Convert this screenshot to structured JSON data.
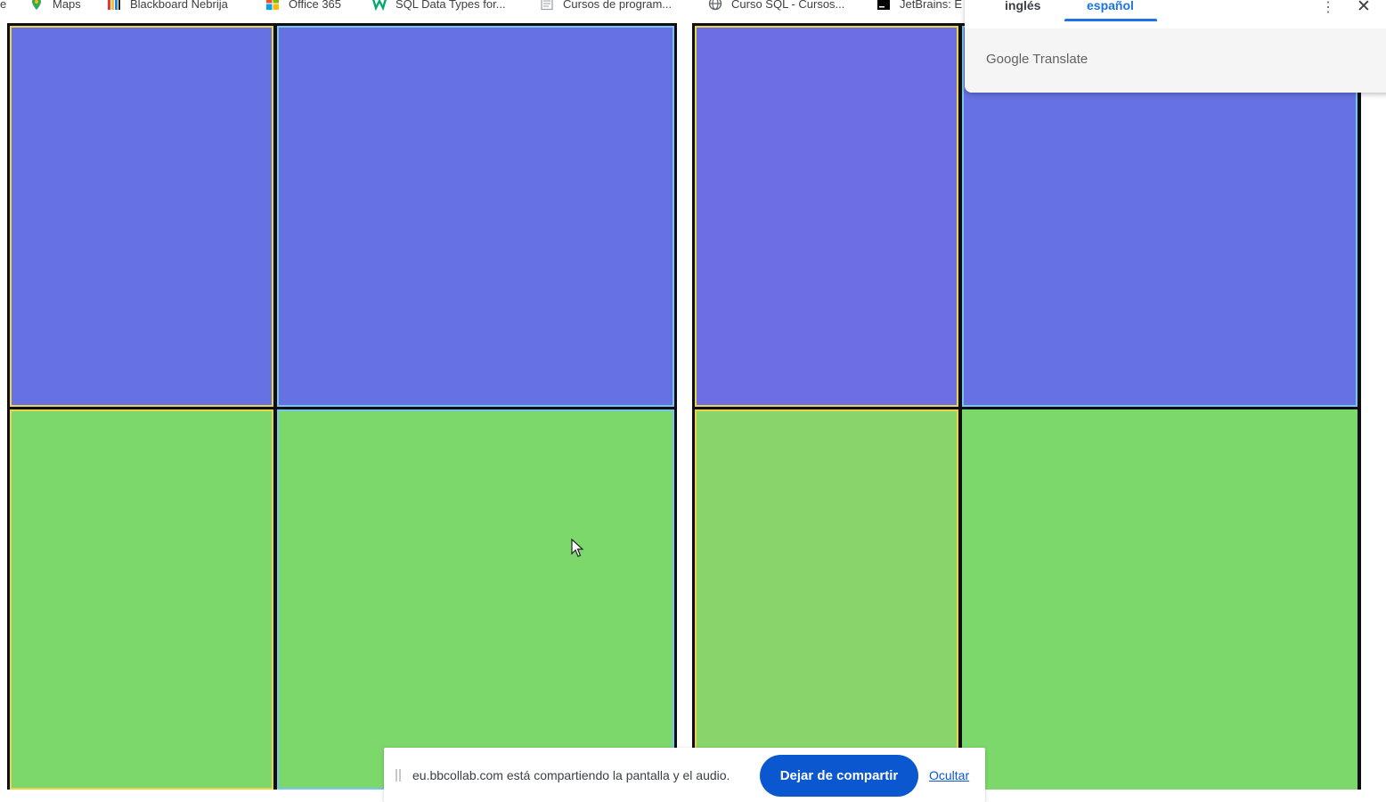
{
  "bookmarks": [
    {
      "label": "e",
      "icon": "page-edge-icon"
    },
    {
      "label": "Maps",
      "icon": "maps-pin-icon"
    },
    {
      "label": "Blackboard Nebrija",
      "icon": "blackboard-icon"
    },
    {
      "label": "Office 365",
      "icon": "office-icon"
    },
    {
      "label": "SQL Data Types for...",
      "icon": "w3schools-icon"
    },
    {
      "label": "Cursos de program...",
      "icon": "document-icon"
    },
    {
      "label": "Curso SQL - Cursos...",
      "icon": "globe-icon"
    },
    {
      "label": "JetBrains: E",
      "icon": "jetbrains-icon"
    }
  ],
  "translate_popup": {
    "source_language": "inglés",
    "target_language": "español",
    "brand": "Google Translate",
    "menu_icon": "more-vert-icon",
    "close_icon": "close-icon"
  },
  "share_bar": {
    "message": "eu.bbcollab.com está compartiendo la pantalla y el audio.",
    "stop_label": "Dejar de compartir",
    "hide_label": "Ocultar"
  },
  "colors": {
    "blue_cell": "#6671e2",
    "green_cell": "#7dd86c",
    "accent": "#0b57d0",
    "tab_active": "#1a73e8"
  }
}
